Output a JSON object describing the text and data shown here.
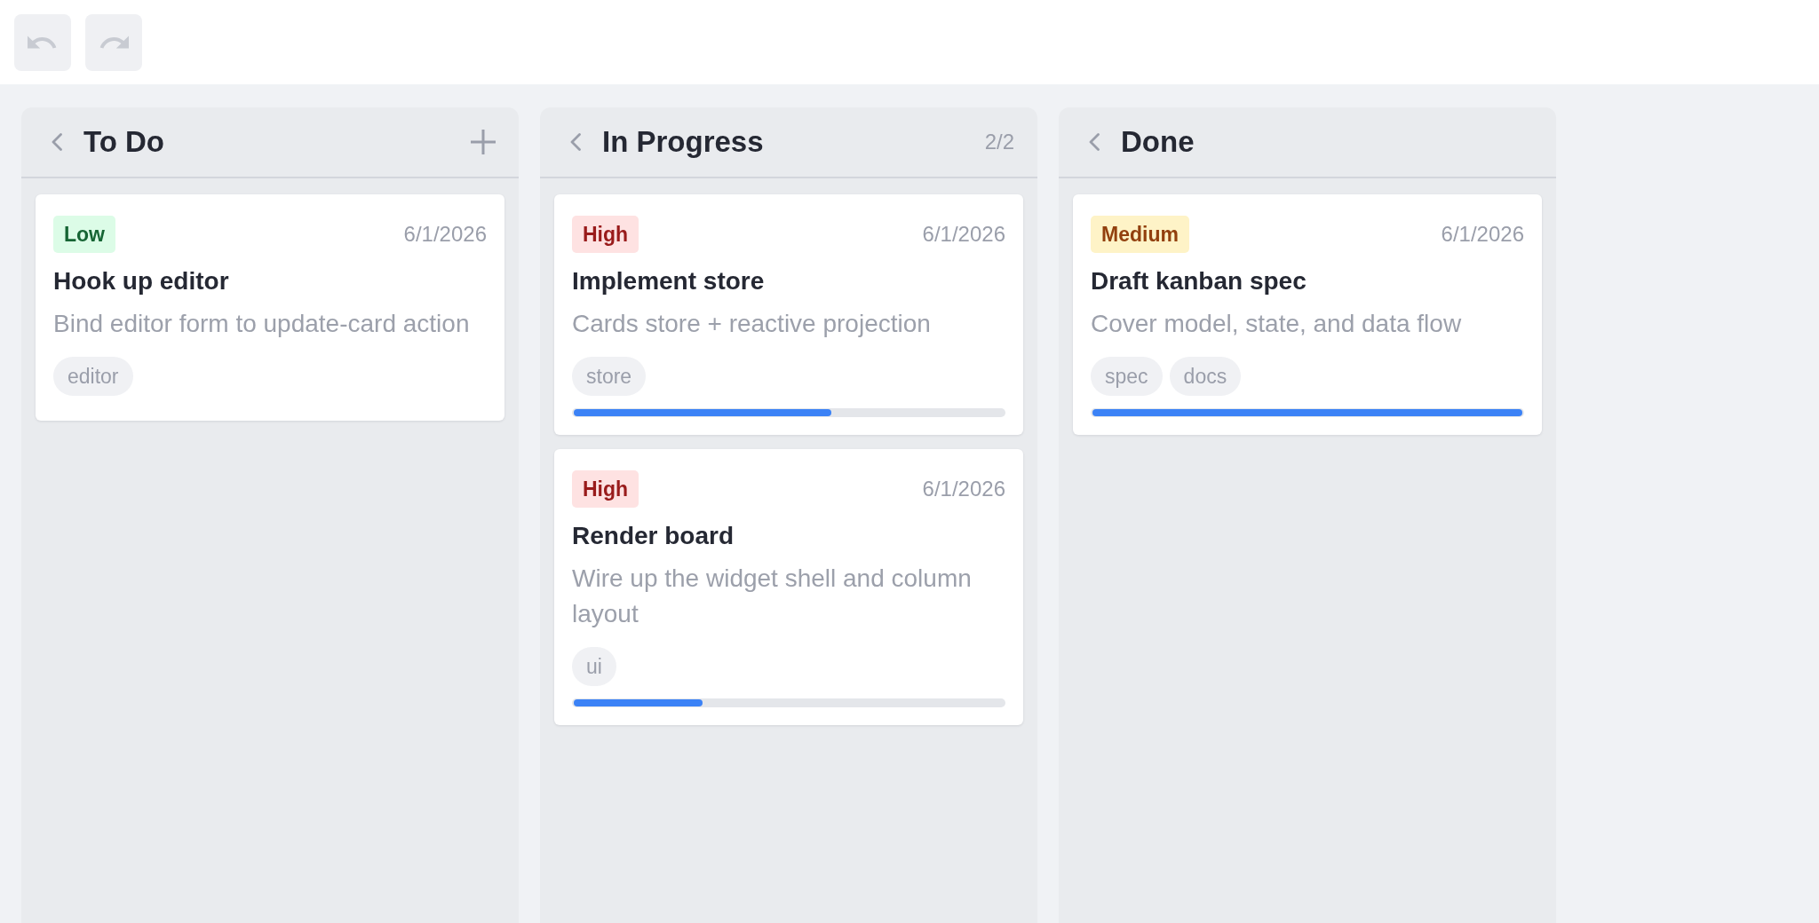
{
  "toolbar": [
    {
      "kind": "undo",
      "disabled": true
    },
    {
      "kind": "redo",
      "disabled": true
    }
  ],
  "columns": [
    {
      "title": "To Do",
      "add_button": true,
      "cards": [
        {
          "priority": {
            "label": "Low",
            "kind": "low"
          },
          "date": "6/1/2026",
          "title": "Hook up editor",
          "description": "Bind editor form to update-card action",
          "tags": [
            "editor"
          ]
        }
      ]
    },
    {
      "title": "In Progress",
      "count": "2/2",
      "add_button": false,
      "cards": [
        {
          "priority": {
            "label": "High",
            "kind": "high"
          },
          "date": "6/1/2026",
          "title": "Implement store",
          "description": "Cards store + reactive projection",
          "tags": [
            "store"
          ],
          "level": 0.6
        },
        {
          "priority": {
            "label": "High",
            "kind": "high"
          },
          "date": "6/1/2026",
          "title": "Render board",
          "description": "Wire up the widget shell and column layout",
          "tags": [
            "ui"
          ],
          "level": 0.3
        }
      ]
    },
    {
      "title": "Done",
      "add_button": false,
      "cards": [
        {
          "priority": {
            "label": "Medium",
            "kind": "medium"
          },
          "date": "6/1/2026",
          "title": "Draft kanban spec",
          "description": "Cover model, state, and data flow",
          "tags": [
            "spec",
            "docs"
          ],
          "level": 1
        }
      ]
    }
  ]
}
